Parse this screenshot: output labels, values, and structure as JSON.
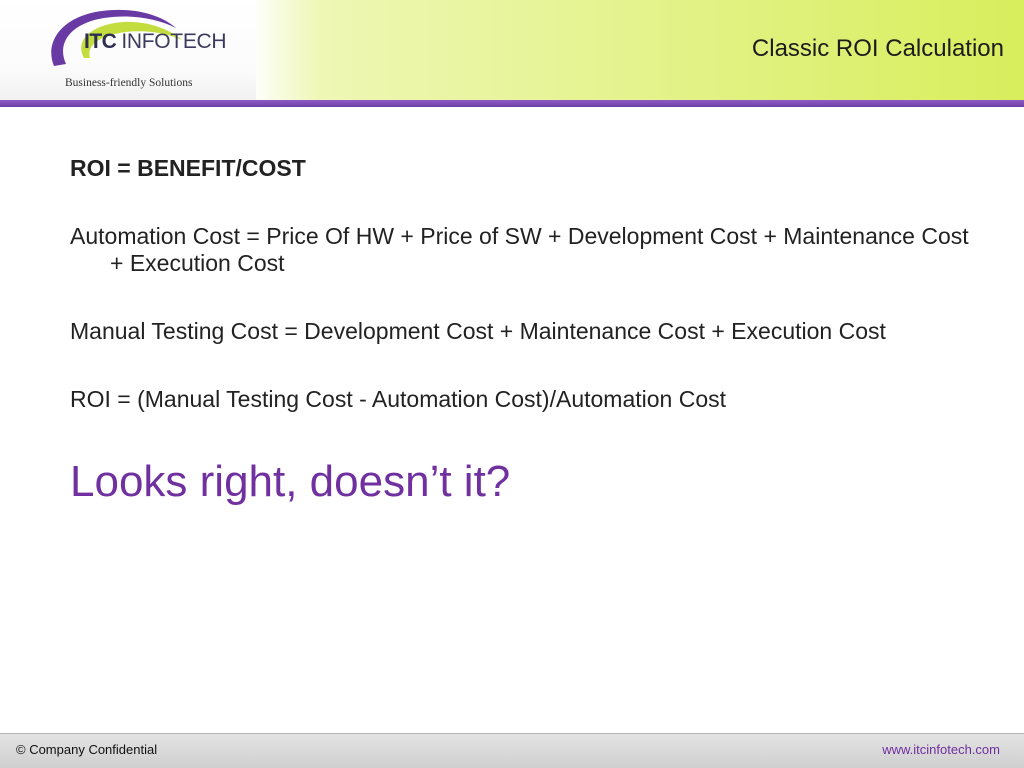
{
  "header": {
    "logo": {
      "brand_bold": "ITC",
      "brand_rest": "INFOTECH",
      "tagline": "Business-friendly Solutions"
    },
    "title": "Classic ROI Calculation"
  },
  "content": {
    "formulas": [
      "ROI = BENEFIT/COST",
      "Automation Cost = Price Of HW + Price of SW + Development Cost + Maintenance Cost + Execution Cost",
      "Manual Testing Cost = Development Cost + Maintenance Cost + Execution Cost",
      "ROI = (Manual Testing Cost - Automation Cost)/Automation Cost"
    ],
    "callout": "Looks right, doesn’t it?"
  },
  "footer": {
    "left": "©  Company Confidential",
    "right": "www.itcinfotech.com"
  },
  "colors": {
    "accent_purple": "#7030a0",
    "header_green": "#d8ee5c",
    "header_rule": "#7a48b4"
  }
}
